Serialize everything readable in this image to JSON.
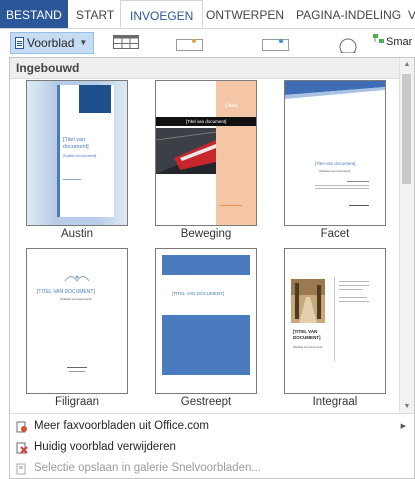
{
  "ribbon": {
    "tabs": [
      {
        "label": "BESTAND"
      },
      {
        "label": "START"
      },
      {
        "label": "INVOEGEN"
      },
      {
        "label": "ONTWERPEN"
      },
      {
        "label": "PAGINA-INDELING"
      },
      {
        "label": "V"
      }
    ],
    "active_tab": "INVOEGEN",
    "voorblad_button": "Voorblad",
    "smart_label": "Smar"
  },
  "gallery": {
    "section_title": "Ingebouwd",
    "templates": [
      {
        "name": "Austin",
        "title_text": "[Titel van document]",
        "subtitle_text": "[Subtitel van document]"
      },
      {
        "name": "Beweging",
        "title_text": "[Titel van document]",
        "year_text": "[Jaar]"
      },
      {
        "name": "Facet",
        "title_text": "[Titel van document]",
        "subtitle_text": "[Subtitel van document]"
      },
      {
        "name": "Filigraan",
        "title_text": "[TITEL VAN DOCUMENT]",
        "subtitle_text": "[Subtitel van document]"
      },
      {
        "name": "Gestreept",
        "title_text": "[TITEL VAN DOCUMENT]"
      },
      {
        "name": "Integraal",
        "title_text": "[TITEL VAN DOCUMENT]",
        "subtitle_text": "[Subtitel van document]"
      }
    ]
  },
  "menu": {
    "items": [
      {
        "label": "Meer faxvoorbladen uit Office.com",
        "icon": "office-icon",
        "enabled": true,
        "submenu": true
      },
      {
        "label": "Huidig voorblad verwijderen",
        "icon": "delete-icon",
        "enabled": true,
        "submenu": false
      },
      {
        "label": "Selectie opslaan in galerie Snelvoorbladen...",
        "icon": "save-selection-icon",
        "enabled": false,
        "submenu": false
      }
    ]
  },
  "colors": {
    "file_tab": "#2b579a",
    "accent_blue": "#4a7bbf",
    "button_highlight": "#c5dcf2",
    "beweging_orange": "#f0b080",
    "delete_red": "#d83b3b"
  }
}
